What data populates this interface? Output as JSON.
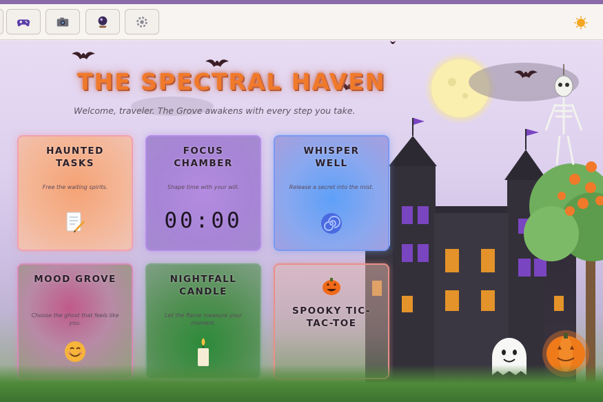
{
  "toolbar": {
    "buttons": [
      {
        "icon": "gamepad-icon"
      },
      {
        "icon": "camera-icon"
      },
      {
        "icon": "crystal-ball-icon"
      },
      {
        "icon": "gear-icon"
      }
    ],
    "theme_toggle_icon": "sun-icon"
  },
  "hero": {
    "title": "THE SPECTRAL HAVEN",
    "welcome": "Welcome, traveler. The Grove awakens with every step you take."
  },
  "cards": [
    {
      "title": "HAUNTED TASKS",
      "subtitle": "Free the waiting spirits.",
      "icon": "memo-icon",
      "color": "#f6b48a"
    },
    {
      "title": "FOCUS CHAMBER",
      "subtitle": "Shape time with your will.",
      "timer": "00:00",
      "color": "#a987d8"
    },
    {
      "title": "WHISPER WELL",
      "subtitle": "Release a secret into the mist.",
      "icon": "swirl-icon",
      "color": "#7aa0f0"
    },
    {
      "title": "MOOD GROVE",
      "subtitle": "Choose the ghost that feels like you.",
      "icon": "smile-icon",
      "color": "#c688a6"
    },
    {
      "title": "NIGHTFALL CANDLE",
      "subtitle": "Let the flame measure your moment.",
      "icon": "candle-icon",
      "color": "#6f9c72"
    },
    {
      "title": "SPOOKY TIC-TAC-TOE",
      "icon": "jack-o-lantern-icon",
      "color": "#d8a08c"
    }
  ]
}
